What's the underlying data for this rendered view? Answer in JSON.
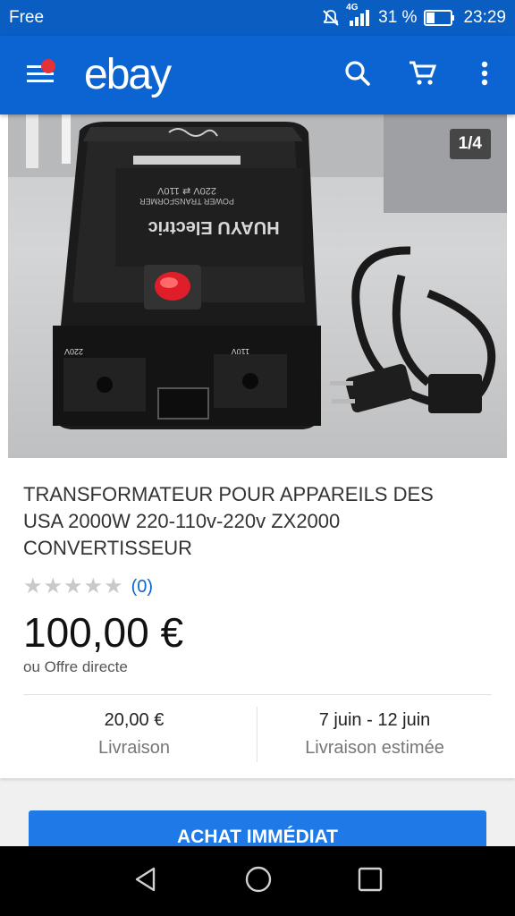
{
  "status_bar": {
    "carrier": "Free",
    "network": "4G",
    "battery": "31 %",
    "time": "23:29"
  },
  "app_bar": {
    "logo": "ebay",
    "icons": [
      "menu-icon",
      "search-icon",
      "cart-icon",
      "more-vert-icon"
    ]
  },
  "gallery": {
    "counter": "1/4",
    "image_label": {
      "brand": "HUAYU Electric",
      "subtitle": "POWER TRANSFORMER",
      "voltage": "220V ⇄ 110V",
      "left_outlet": "220V",
      "right_outlet": "110V"
    }
  },
  "product": {
    "title": "TRANSFORMATEUR POUR APPAREILS DES USA 2000W 220-110v-220v ZX2000 CONVERTISSEUR",
    "rating_count": "(0)",
    "stars": 0,
    "price": "100,00 €",
    "offer": "ou Offre directe"
  },
  "shipping": {
    "cost": "20,00 €",
    "cost_label": "Livraison",
    "dates": "7 juin - 12 juin",
    "dates_label": "Livraison estimée"
  },
  "actions": {
    "buy_now": "ACHAT IMMÉDIAT"
  },
  "colors": {
    "app_bar": "#0c64d2",
    "status_bar": "#0a5ec2",
    "button": "#1f7ae8",
    "notification_dot": "#e53238",
    "link": "#0c64d2"
  }
}
